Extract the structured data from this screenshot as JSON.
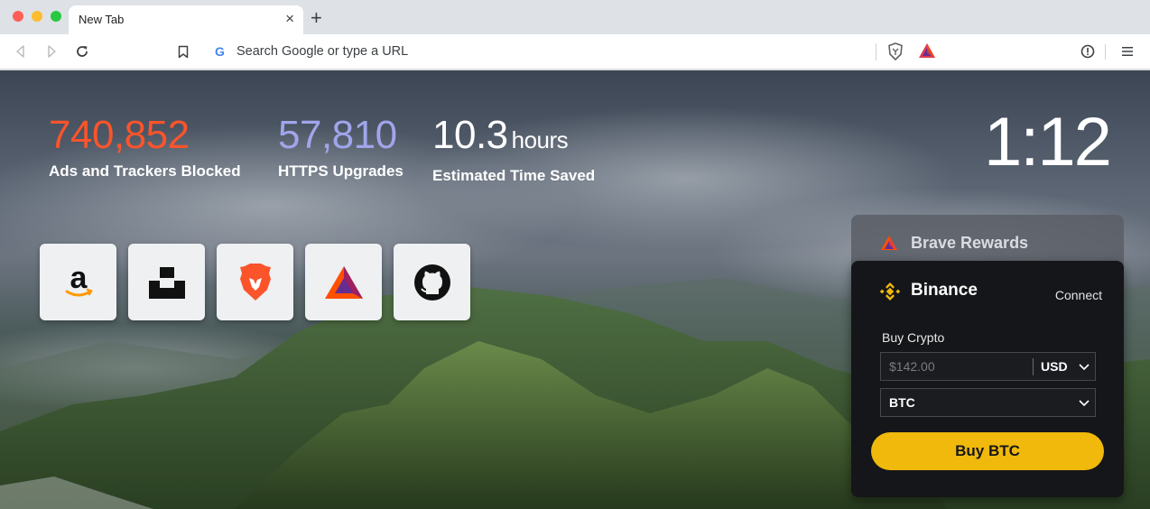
{
  "tab": {
    "title": "New Tab",
    "close_glyph": "×",
    "new_tab_glyph": "+"
  },
  "toolbar": {
    "back_icon": "back-arrow-icon",
    "forward_icon": "forward-arrow-icon",
    "reload_icon": "reload-icon",
    "bookmark_icon": "bookmark-icon",
    "search_engine_glyph": "G",
    "omnibox_placeholder": "Search Google or type a URL",
    "shield_icon": "brave-shields-icon",
    "rewards_icon": "bat-rewards-icon",
    "info_icon": "info-icon",
    "menu_icon": "hamburger-menu-icon"
  },
  "stats": {
    "ads_blocked": {
      "value": "740,852",
      "label": "Ads and Trackers Blocked",
      "color": "#fb542b"
    },
    "https_upgrades": {
      "value": "57,810",
      "label": "HTTPS Upgrades",
      "color": "#a0a5eb"
    },
    "time_saved": {
      "value": "10.3",
      "unit": "hours",
      "label": "Estimated Time Saved",
      "color": "#ffffff"
    }
  },
  "clock": {
    "time": "1:12"
  },
  "top_sites": [
    {
      "name": "amazon",
      "icon": "amazon-logo-icon"
    },
    {
      "name": "unsplash",
      "icon": "unsplash-logo-icon"
    },
    {
      "name": "brave",
      "icon": "brave-lion-icon"
    },
    {
      "name": "basic attention token",
      "icon": "bat-logo-icon"
    },
    {
      "name": "github",
      "icon": "github-octocat-icon"
    }
  ],
  "rewards_widget": {
    "title": "Brave Rewards"
  },
  "binance_widget": {
    "title": "Binance",
    "connect_label": "Connect",
    "buy_crypto_label": "Buy Crypto",
    "amount_placeholder": "$142.00",
    "currency": "USD",
    "asset": "BTC",
    "buy_button_label": "Buy BTC",
    "accent_color": "#f0b90b"
  }
}
